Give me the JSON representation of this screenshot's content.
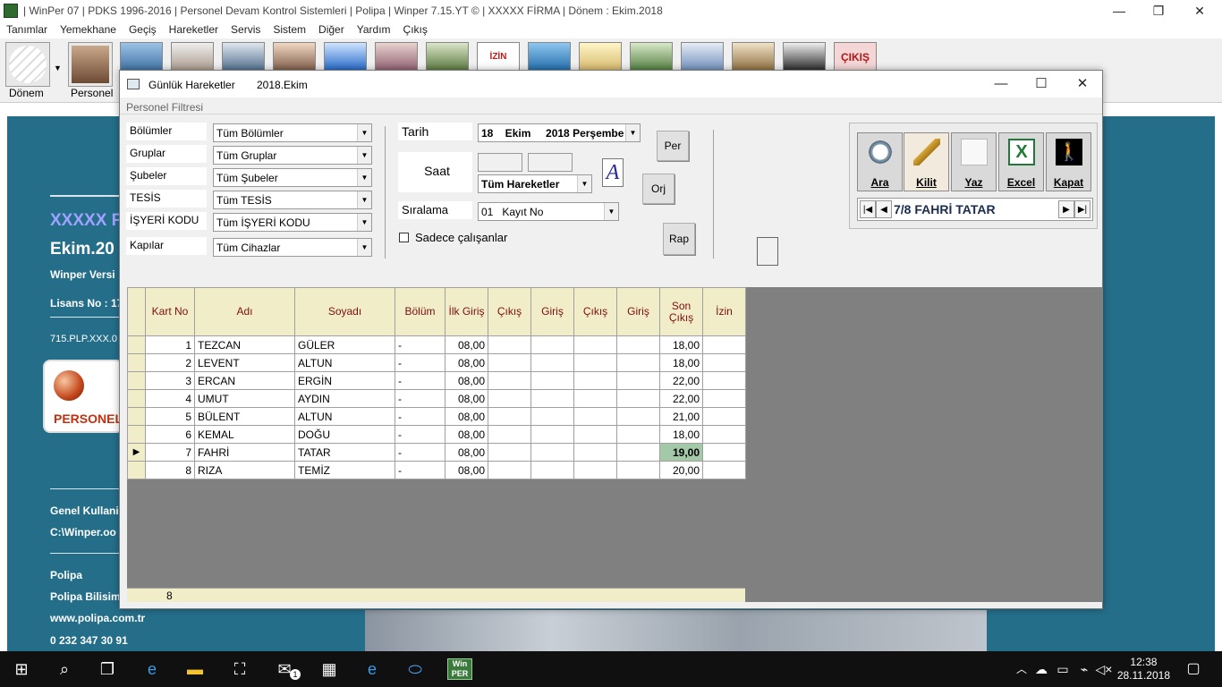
{
  "window": {
    "title": "| WinPer 07 | PDKS 1996-2016 | Personel Devam Kontrol Sistemleri | Polipa | Winper 7.15.YT © | XXXXX FİRMA | Dönem : Ekim.2018",
    "minimize": "—",
    "restore": "❐",
    "close": "✕"
  },
  "menu": [
    "Tanımlar",
    "Yemekhane",
    "Geçiş",
    "Hareketler",
    "Servis",
    "Sistem",
    "Diğer",
    "Yardım",
    "Çıkış"
  ],
  "toolbar": {
    "donem_label": "Dönem",
    "personel_label": "Personel",
    "cikis_label": "ÇIKIŞ",
    "izin_label": "İZİN"
  },
  "desktop": {
    "firm": "XXXXX F",
    "period": "Ekim.20",
    "version": "Winper Versi",
    "license": "Lisans No : 17",
    "code": "715.PLP.XXX.0",
    "logo_text": "PERSONEL",
    "user": "Genel Kullanic",
    "path": "C:\\Winper.oo",
    "company": "Polipa",
    "company2": "Polipa Bilisim",
    "web": "www.polipa.com.tr",
    "phone": "0 232 347 30 91"
  },
  "dialog": {
    "title": "Günlük Hareketler",
    "period": "2018.Ekim",
    "section": "Personel Filtresi",
    "filters": [
      {
        "label": "Bölümler",
        "value": "Tüm Bölümler"
      },
      {
        "label": "Gruplar",
        "value": "Tüm Gruplar"
      },
      {
        "label": "Şubeler",
        "value": "Tüm Şubeler"
      },
      {
        "label": "TESİS",
        "value": "Tüm TESİS"
      },
      {
        "label": "İŞYERİ KODU",
        "value": "Tüm İŞYERİ KODU"
      },
      {
        "label": "Kapılar",
        "value": "Tüm Cihazlar"
      }
    ],
    "tarih_label": "Tarih",
    "tarih_value": "18    Ekim     2018 Perşembe",
    "saat_label": "Saat",
    "hareket_value": "Tüm Hareketler",
    "siralama_label": "Sıralama",
    "siralama_value": "01   Kayıt No",
    "sadece_label": "Sadece çalışanlar",
    "per_btn": "Per",
    "orj_btn": "Orj",
    "rap_btn": "Rap",
    "actions": [
      "Ara",
      "Kilit",
      "Yaz",
      "Excel",
      "Kapat"
    ],
    "nav_text": "7/8  FAHRİ TATAR"
  },
  "grid": {
    "headers": [
      "Kart No",
      "Adı",
      "Soyadı",
      "Bölüm",
      "İlk Giriş",
      "Çıkış",
      "Giriş",
      "Çıkış",
      "Giriş",
      "Son Çıkış",
      "İzin"
    ],
    "rows": [
      {
        "kart": "1",
        "adi": "TEZCAN",
        "soyadi": "GÜLER",
        "bolum": "-",
        "ilk": "08,00",
        "son": "18,00"
      },
      {
        "kart": "2",
        "adi": "LEVENT",
        "soyadi": "ALTUN",
        "bolum": "-",
        "ilk": "08,00",
        "son": "18,00"
      },
      {
        "kart": "3",
        "adi": "ERCAN",
        "soyadi": "ERGİN",
        "bolum": "-",
        "ilk": "08,00",
        "son": "22,00"
      },
      {
        "kart": "4",
        "adi": "UMUT",
        "soyadi": "AYDIN",
        "bolum": "-",
        "ilk": "08,00",
        "son": "22,00"
      },
      {
        "kart": "5",
        "adi": "BÜLENT",
        "soyadi": "ALTUN",
        "bolum": "-",
        "ilk": "08,00",
        "son": "21,00"
      },
      {
        "kart": "6",
        "adi": "KEMAL",
        "soyadi": "DOĞU",
        "bolum": "-",
        "ilk": "08,00",
        "son": "18,00"
      },
      {
        "kart": "7",
        "adi": "FAHRİ",
        "soyadi": "TATAR",
        "bolum": "-",
        "ilk": "08,00",
        "son": "19,00"
      },
      {
        "kart": "8",
        "adi": "RIZA",
        "soyadi": "TEMİZ",
        "bolum": "-",
        "ilk": "08,00",
        "son": "20,00"
      }
    ],
    "selected_row": 7,
    "count": "8"
  },
  "taskbar": {
    "time": "12:38",
    "date": "28.11.2018",
    "badge": "1"
  }
}
